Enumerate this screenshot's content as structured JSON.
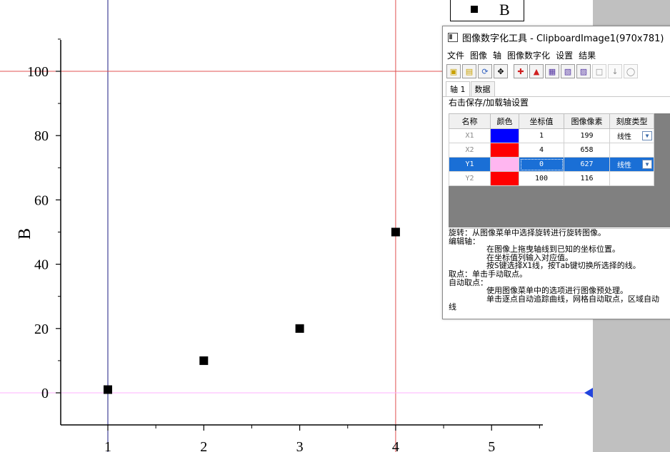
{
  "plot": {
    "ylabel": "B",
    "y_ticks": [
      "0",
      "20",
      "40",
      "60",
      "80",
      "100"
    ],
    "x_ticks": [
      "1",
      "2",
      "3",
      "4",
      "5"
    ]
  },
  "legend": {
    "label": "B"
  },
  "chart_data": {
    "type": "scatter",
    "x": [
      1,
      2,
      3,
      4
    ],
    "y": [
      1,
      10,
      20,
      50
    ],
    "xlabel": "",
    "ylabel": "B",
    "xlim": [
      0.5,
      5.5
    ],
    "ylim": [
      -10,
      112
    ],
    "series": [
      {
        "name": "B",
        "x": [
          1,
          2,
          3,
          4
        ],
        "y": [
          1,
          10,
          20,
          50
        ]
      }
    ]
  },
  "guides": {
    "x1_color": "#1a1a80",
    "x2_color": "#e05050",
    "y1_color": "#ffb0ff",
    "y2_color": "#e05050"
  },
  "dialog": {
    "title": "图像数字化工具 - ClipboardImage1(970x781)",
    "menu": [
      "文件",
      "图像",
      "轴",
      "图像数字化",
      "设置",
      "结果"
    ],
    "toolbar_icons": [
      "open-folder-icon",
      "open-image-icon",
      "rotate-icon",
      "move-axes-icon",
      "pick-points-icon",
      "digitize-icon",
      "grid-digitize-icon",
      "region-icon",
      "trace-curve-icon",
      "disabled-tool-icon",
      "disabled-sort-icon",
      "disabled-clear-icon"
    ],
    "tabs": [
      "轴 1",
      "数据"
    ],
    "hint": "右击保存/加载轴设置",
    "table": {
      "headers": [
        "名称",
        "颜色",
        "坐标值",
        "图像像素",
        "刻度类型"
      ],
      "rows": [
        {
          "name": "X1",
          "color": "#0000ff",
          "value": "1",
          "pixel": "199",
          "scale": "线性",
          "selected": false
        },
        {
          "name": "X2",
          "color": "#ff0000",
          "value": "4",
          "pixel": "658",
          "scale": "",
          "selected": false
        },
        {
          "name": "Y1",
          "color": "#ffb6f0",
          "value": "0",
          "pixel": "627",
          "scale": "线性",
          "selected": true
        },
        {
          "name": "Y2",
          "color": "#ff0000",
          "value": "100",
          "pixel": "116",
          "scale": "",
          "selected": false
        }
      ]
    },
    "info_lines": [
      "旋转：从图像菜单中选择旋转进行旋转图像。",
      "编辑轴：",
      "        在图像上拖曳轴线到已知的坐标位置。",
      "        在坐标值列输入对应值。",
      "        按S键选择X1线，按Tab键切换所选择的线。",
      "取点：单击手动取点。",
      "自动取点：",
      "        使用图像菜单中的选项进行图像预处理。",
      "        单击逐点自动追踪曲线，网格自动取点，区域自动",
      "线"
    ]
  }
}
